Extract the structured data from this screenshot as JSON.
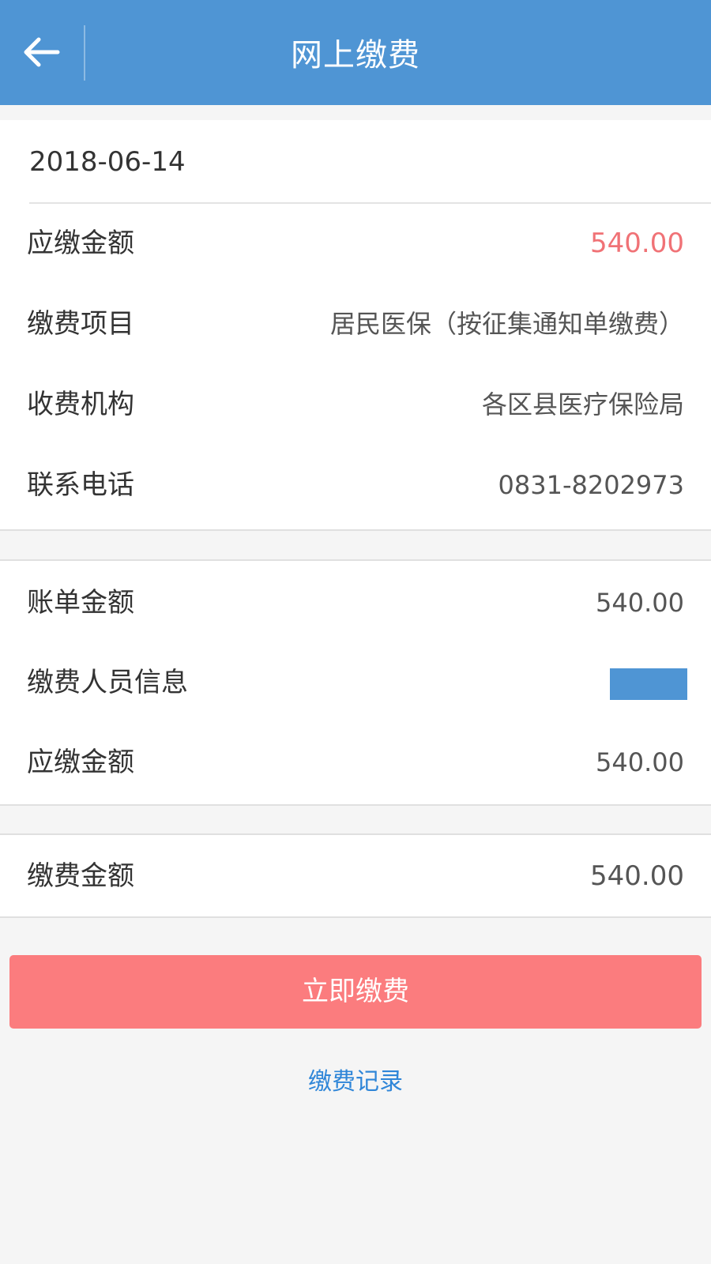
{
  "header": {
    "title": "网上缴费",
    "back_icon": "arrow-left-icon"
  },
  "bill": {
    "date": "2018-06-14",
    "rows": [
      {
        "label": "应缴金额",
        "value": "540.00"
      },
      {
        "label": "缴费项目",
        "value": "居民医保（按征集通知单缴费）"
      },
      {
        "label": "收费机构",
        "value": "各区县医疗保险局"
      },
      {
        "label": "联系电话",
        "value": "0831-8202973"
      }
    ]
  },
  "detail": {
    "rows": [
      {
        "label": "账单金额",
        "value": "540.00"
      },
      {
        "label": "缴费人员信息"
      },
      {
        "label": "应缴金额",
        "value": "540.00"
      }
    ]
  },
  "payment": {
    "label": "缴费金额",
    "value": "540.00"
  },
  "actions": {
    "pay_now": "立即缴费",
    "records": "缴费记录"
  },
  "colors": {
    "header_bg": "#4f95d4",
    "amount_red": "#f07276",
    "pay_button": "#fb7c7e",
    "link_blue": "#2f86d8"
  }
}
